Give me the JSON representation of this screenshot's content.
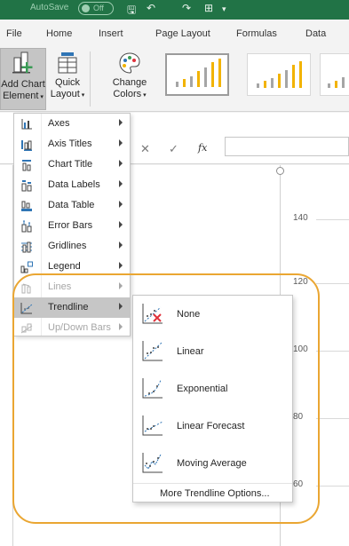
{
  "titlebar": {
    "autosave_label": "AutoSave",
    "autosave_state": "Off",
    "bg_color": "#217346"
  },
  "tabs": [
    "File",
    "Home",
    "Insert",
    "Page Layout",
    "Formulas",
    "Data"
  ],
  "ribbon": {
    "add_chart_line1": "Add Chart",
    "add_chart_line2": "Element",
    "quick_layout_line1": "Quick",
    "quick_layout_line2": "Layout",
    "change_colors_line1": "Change",
    "change_colors_line2": "Colors"
  },
  "formula_bar": {
    "cancel_glyph": "✕",
    "enter_glyph": "✓",
    "fx_label": "fx"
  },
  "add_chart_menu": {
    "items": [
      {
        "label": "Axes",
        "underline": "x",
        "icon": "axes-icon",
        "disabled": false
      },
      {
        "label": "Axis Titles",
        "underline": "A",
        "icon": "axis-titles-icon",
        "disabled": false
      },
      {
        "label": "Chart Title",
        "underline": "C",
        "icon": "chart-title-icon",
        "disabled": false
      },
      {
        "label": "Data Labels",
        "underline": "D",
        "icon": "data-labels-icon",
        "disabled": false
      },
      {
        "label": "Data Table",
        "underline": "b",
        "icon": "data-table-icon",
        "disabled": false
      },
      {
        "label": "Error Bars",
        "underline": "E",
        "icon": "error-bars-icon",
        "disabled": false
      },
      {
        "label": "Gridlines",
        "underline": "G",
        "icon": "gridlines-icon",
        "disabled": false
      },
      {
        "label": "Legend",
        "underline": "L",
        "icon": "legend-icon",
        "disabled": false
      },
      {
        "label": "Lines",
        "underline": "i",
        "icon": "lines-icon",
        "disabled": true
      },
      {
        "label": "Trendline",
        "underline": "T",
        "icon": "trendline-icon",
        "disabled": false,
        "active": true
      },
      {
        "label": "Up/Down Bars",
        "underline": "U",
        "icon": "up-down-bars-icon",
        "disabled": true
      }
    ]
  },
  "trendline_menu": {
    "items": [
      {
        "label": "None",
        "underline": "N",
        "icon": "trendline-none-icon"
      },
      {
        "label": "Linear",
        "underline": "L",
        "icon": "trendline-linear-icon"
      },
      {
        "label": "Exponential",
        "underline": "E",
        "icon": "trendline-exponential-icon"
      },
      {
        "label": "Linear Forecast",
        "underline": "F",
        "icon": "trendline-linear-forecast-icon"
      },
      {
        "label": "Moving Average",
        "underline": "",
        "icon": "trendline-moving-average-icon"
      }
    ],
    "more_label": "More Trendline Options...",
    "more_underline": "M"
  },
  "chart": {
    "y_ticks": [
      "140",
      "120",
      "100",
      "80",
      "60"
    ]
  },
  "colors": {
    "accent_green": "#217346",
    "highlight_orange": "#eaa632",
    "bar_gold": "#f2b300",
    "bar_gray": "#a5a5a5",
    "trend_blue": "#2f75b5",
    "none_red": "#e0323c"
  }
}
